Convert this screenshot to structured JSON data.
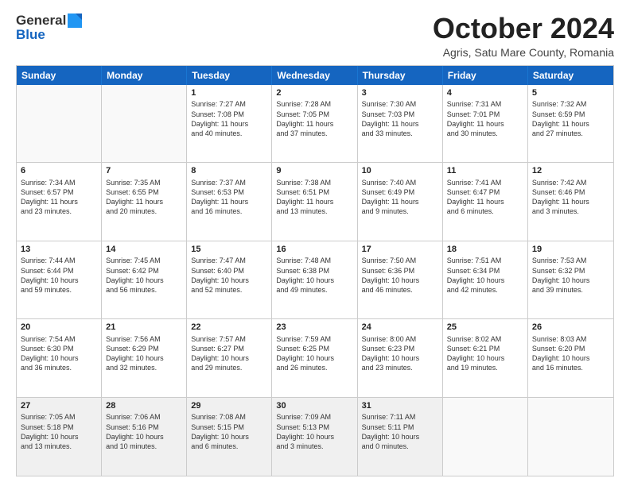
{
  "header": {
    "logo_general": "General",
    "logo_blue": "Blue",
    "month_title": "October 2024",
    "location": "Agris, Satu Mare County, Romania"
  },
  "days_of_week": [
    "Sunday",
    "Monday",
    "Tuesday",
    "Wednesday",
    "Thursday",
    "Friday",
    "Saturday"
  ],
  "weeks": [
    [
      {
        "day": "",
        "empty": true
      },
      {
        "day": "",
        "empty": true
      },
      {
        "day": "1",
        "line1": "Sunrise: 7:27 AM",
        "line2": "Sunset: 7:08 PM",
        "line3": "Daylight: 11 hours",
        "line4": "and 40 minutes."
      },
      {
        "day": "2",
        "line1": "Sunrise: 7:28 AM",
        "line2": "Sunset: 7:05 PM",
        "line3": "Daylight: 11 hours",
        "line4": "and 37 minutes."
      },
      {
        "day": "3",
        "line1": "Sunrise: 7:30 AM",
        "line2": "Sunset: 7:03 PM",
        "line3": "Daylight: 11 hours",
        "line4": "and 33 minutes."
      },
      {
        "day": "4",
        "line1": "Sunrise: 7:31 AM",
        "line2": "Sunset: 7:01 PM",
        "line3": "Daylight: 11 hours",
        "line4": "and 30 minutes."
      },
      {
        "day": "5",
        "line1": "Sunrise: 7:32 AM",
        "line2": "Sunset: 6:59 PM",
        "line3": "Daylight: 11 hours",
        "line4": "and 27 minutes."
      }
    ],
    [
      {
        "day": "6",
        "line1": "Sunrise: 7:34 AM",
        "line2": "Sunset: 6:57 PM",
        "line3": "Daylight: 11 hours",
        "line4": "and 23 minutes."
      },
      {
        "day": "7",
        "line1": "Sunrise: 7:35 AM",
        "line2": "Sunset: 6:55 PM",
        "line3": "Daylight: 11 hours",
        "line4": "and 20 minutes."
      },
      {
        "day": "8",
        "line1": "Sunrise: 7:37 AM",
        "line2": "Sunset: 6:53 PM",
        "line3": "Daylight: 11 hours",
        "line4": "and 16 minutes."
      },
      {
        "day": "9",
        "line1": "Sunrise: 7:38 AM",
        "line2": "Sunset: 6:51 PM",
        "line3": "Daylight: 11 hours",
        "line4": "and 13 minutes."
      },
      {
        "day": "10",
        "line1": "Sunrise: 7:40 AM",
        "line2": "Sunset: 6:49 PM",
        "line3": "Daylight: 11 hours",
        "line4": "and 9 minutes."
      },
      {
        "day": "11",
        "line1": "Sunrise: 7:41 AM",
        "line2": "Sunset: 6:47 PM",
        "line3": "Daylight: 11 hours",
        "line4": "and 6 minutes."
      },
      {
        "day": "12",
        "line1": "Sunrise: 7:42 AM",
        "line2": "Sunset: 6:46 PM",
        "line3": "Daylight: 11 hours",
        "line4": "and 3 minutes."
      }
    ],
    [
      {
        "day": "13",
        "line1": "Sunrise: 7:44 AM",
        "line2": "Sunset: 6:44 PM",
        "line3": "Daylight: 10 hours",
        "line4": "and 59 minutes."
      },
      {
        "day": "14",
        "line1": "Sunrise: 7:45 AM",
        "line2": "Sunset: 6:42 PM",
        "line3": "Daylight: 10 hours",
        "line4": "and 56 minutes."
      },
      {
        "day": "15",
        "line1": "Sunrise: 7:47 AM",
        "line2": "Sunset: 6:40 PM",
        "line3": "Daylight: 10 hours",
        "line4": "and 52 minutes."
      },
      {
        "day": "16",
        "line1": "Sunrise: 7:48 AM",
        "line2": "Sunset: 6:38 PM",
        "line3": "Daylight: 10 hours",
        "line4": "and 49 minutes."
      },
      {
        "day": "17",
        "line1": "Sunrise: 7:50 AM",
        "line2": "Sunset: 6:36 PM",
        "line3": "Daylight: 10 hours",
        "line4": "and 46 minutes."
      },
      {
        "day": "18",
        "line1": "Sunrise: 7:51 AM",
        "line2": "Sunset: 6:34 PM",
        "line3": "Daylight: 10 hours",
        "line4": "and 42 minutes."
      },
      {
        "day": "19",
        "line1": "Sunrise: 7:53 AM",
        "line2": "Sunset: 6:32 PM",
        "line3": "Daylight: 10 hours",
        "line4": "and 39 minutes."
      }
    ],
    [
      {
        "day": "20",
        "line1": "Sunrise: 7:54 AM",
        "line2": "Sunset: 6:30 PM",
        "line3": "Daylight: 10 hours",
        "line4": "and 36 minutes."
      },
      {
        "day": "21",
        "line1": "Sunrise: 7:56 AM",
        "line2": "Sunset: 6:29 PM",
        "line3": "Daylight: 10 hours",
        "line4": "and 32 minutes."
      },
      {
        "day": "22",
        "line1": "Sunrise: 7:57 AM",
        "line2": "Sunset: 6:27 PM",
        "line3": "Daylight: 10 hours",
        "line4": "and 29 minutes."
      },
      {
        "day": "23",
        "line1": "Sunrise: 7:59 AM",
        "line2": "Sunset: 6:25 PM",
        "line3": "Daylight: 10 hours",
        "line4": "and 26 minutes."
      },
      {
        "day": "24",
        "line1": "Sunrise: 8:00 AM",
        "line2": "Sunset: 6:23 PM",
        "line3": "Daylight: 10 hours",
        "line4": "and 23 minutes."
      },
      {
        "day": "25",
        "line1": "Sunrise: 8:02 AM",
        "line2": "Sunset: 6:21 PM",
        "line3": "Daylight: 10 hours",
        "line4": "and 19 minutes."
      },
      {
        "day": "26",
        "line1": "Sunrise: 8:03 AM",
        "line2": "Sunset: 6:20 PM",
        "line3": "Daylight: 10 hours",
        "line4": "and 16 minutes."
      }
    ],
    [
      {
        "day": "27",
        "line1": "Sunrise: 7:05 AM",
        "line2": "Sunset: 5:18 PM",
        "line3": "Daylight: 10 hours",
        "line4": "and 13 minutes."
      },
      {
        "day": "28",
        "line1": "Sunrise: 7:06 AM",
        "line2": "Sunset: 5:16 PM",
        "line3": "Daylight: 10 hours",
        "line4": "and 10 minutes."
      },
      {
        "day": "29",
        "line1": "Sunrise: 7:08 AM",
        "line2": "Sunset: 5:15 PM",
        "line3": "Daylight: 10 hours",
        "line4": "and 6 minutes."
      },
      {
        "day": "30",
        "line1": "Sunrise: 7:09 AM",
        "line2": "Sunset: 5:13 PM",
        "line3": "Daylight: 10 hours",
        "line4": "and 3 minutes."
      },
      {
        "day": "31",
        "line1": "Sunrise: 7:11 AM",
        "line2": "Sunset: 5:11 PM",
        "line3": "Daylight: 10 hours",
        "line4": "and 0 minutes."
      },
      {
        "day": "",
        "empty": true
      },
      {
        "day": "",
        "empty": true
      }
    ]
  ]
}
